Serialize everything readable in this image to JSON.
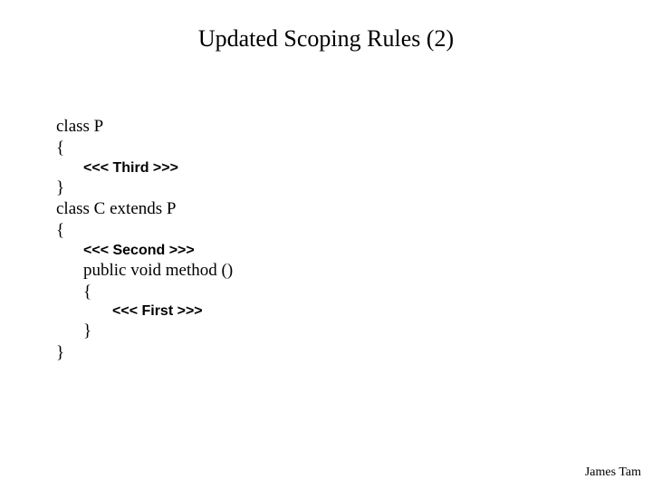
{
  "title": "Updated Scoping Rules (2)",
  "code": {
    "l1": "class P",
    "l2": "{",
    "marker3": "<<< Third >>>",
    "l3": "}",
    "l4": "class C extends P",
    "l5": "{",
    "marker2": "<<< Second >>>",
    "l6": "public void method ()",
    "l7": "{",
    "marker1": "<<< First >>>",
    "l8": "}",
    "l9": "}"
  },
  "footer": "James Tam"
}
